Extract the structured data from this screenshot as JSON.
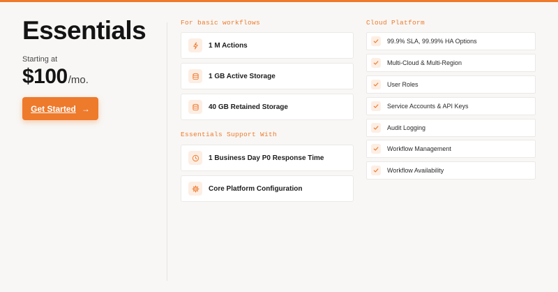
{
  "plan": {
    "name": "Essentials",
    "starting_label": "Starting at",
    "price": "$100",
    "period": "/mo.",
    "cta_label": "Get Started"
  },
  "workflows": {
    "heading": "For basic workflows",
    "items": [
      {
        "label": "1 M Actions",
        "icon": "lightning-icon"
      },
      {
        "label": "1 GB Active Storage",
        "icon": "database-icon"
      },
      {
        "label": "40 GB Retained Storage",
        "icon": "storage-icon"
      }
    ]
  },
  "support": {
    "heading": "Essentials Support With",
    "items": [
      {
        "label": "1 Business Day P0 Response Time",
        "icon": "clock-icon"
      },
      {
        "label": "Core Platform Configuration",
        "icon": "gear-icon"
      }
    ]
  },
  "cloud": {
    "heading": "Cloud Platform",
    "items": [
      "99.9% SLA, 99.99% HA Options",
      "Multi-Cloud & Multi-Region",
      "User Roles",
      "Service Accounts & API Keys",
      "Audit Logging",
      "Workflow Management",
      "Workflow Availability"
    ]
  },
  "colors": {
    "accent": "#ee7a2c",
    "accent_tint": "#fdeee4",
    "background": "#f8f7f5"
  }
}
